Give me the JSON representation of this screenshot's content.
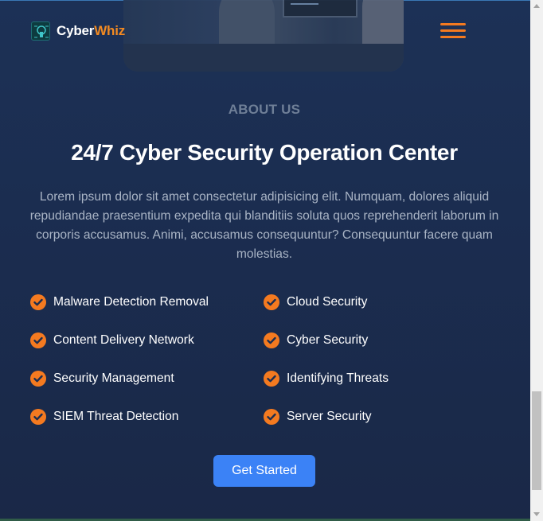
{
  "header": {
    "logo_primary": "Cyber",
    "logo_accent": "Whiz",
    "menu_icon": "hamburger-menu-icon"
  },
  "hero": {
    "image_icon": "team-working-image"
  },
  "about": {
    "eyebrow": "ABOUT US",
    "title": "24/7 Cyber Security Operation Center",
    "description": "Lorem ipsum dolor sit amet consectetur adipisicing elit. Numquam, dolores aliquid repudiandae praesentium expedita qui blanditiis soluta quos reprehenderit laborum in corporis accusamus. Animi, accusamus consequuntur? Consequuntur facere quam molestias.",
    "features": [
      "Malware Detection Removal",
      "Cloud Security",
      "Content Delivery Network",
      "Cyber Security",
      "Security Management",
      "Identifying Threats",
      "SIEM Threat Detection",
      "Server Security"
    ],
    "cta_label": "Get Started"
  },
  "colors": {
    "accent": "#f47a20",
    "button": "#3b82f6",
    "background": "#1b2d50"
  }
}
